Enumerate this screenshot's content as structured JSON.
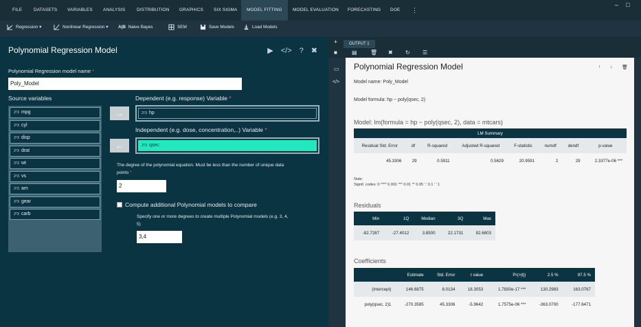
{
  "menubar": {
    "items": [
      "FILE",
      "DATASETS",
      "VARIABLES",
      "ANALYSIS",
      "DISTRIBUTION",
      "GRAPHICS",
      "SIX SIGMA",
      "MODEL FITTING",
      "MODEL EVALUATION",
      "FORECASTING",
      "DOE"
    ],
    "more_icon": "⋮",
    "minimize_icon": "–",
    "maximize_icon": "□",
    "active": "MODEL FITTING"
  },
  "toolbar": {
    "regression": "Regression",
    "nonlinear": "Nonlinear Regression",
    "naive_bayes": "Naive Bayes",
    "naive_prefix": "A|B",
    "sem": "SEM",
    "save_models": "Save Models",
    "load_models": "Load Models"
  },
  "dialog": {
    "title": "Polynomial Regression Model",
    "model_name_label": "Polynomial Regression model name",
    "model_name_value": "Poly_Model",
    "source_label": "Source variables",
    "source_vars": [
      "mpg",
      "cyl",
      "disp",
      "drat",
      "wt",
      "vs",
      "am",
      "gear",
      "carb"
    ],
    "var_icon": "2²3",
    "dependent_label": "Dependent (e.g. response) Variable",
    "dependent_value": "hp",
    "independent_label": "Independent (e.g. dose, concentration,..) Variable",
    "independent_value": "qsec",
    "degree_label_1": "The degree of the polynomial equation. Must be less than the number of unique data",
    "degree_label_2": "points",
    "degree_value": "2",
    "compare_label": "Compute additional Polynomial models to compare",
    "specify_label_1": "Specify one or more degrees to create multiple Polynomial models (e.g. 3, 4,",
    "specify_label_2": "5)",
    "specify_value": "3,4",
    "required_mark": "*",
    "arrow_right": "→",
    "arrow_left": "←",
    "action_run": "▶",
    "action_code": "</>",
    "action_help": "?",
    "action_close": "✖"
  },
  "output": {
    "tab": "OUTPUT 1",
    "plus": "+",
    "title": "Polynomial Regression Model",
    "model_name": "Model name: Poly_Model",
    "model_formula": "Model formula: hp ~ poly(qsec, 2)",
    "lm_heading": "Model: lm(formula = hp ~ poly(qsec, 2), data = mtcars)",
    "lm_caption": "LM Summary",
    "lm_headers": [
      "Residual Std. Error",
      "df",
      "R-squared",
      "Adjusted R-squared",
      "F-statistic",
      "numdf",
      "dendf",
      "p-value"
    ],
    "lm_row": [
      "45.3306",
      "29",
      "0.5911",
      "0.5629",
      "20.9591",
      "2",
      "29",
      "2.3377e-06 ***"
    ],
    "note": "Note:",
    "signif": "Signif. codes: 0 '***' 0.001 '**' 0.01 '*' 0.05 '.' 0.1 ' ' 1",
    "residuals_heading": "Residuals",
    "resid_headers": [
      "Min",
      "1Q",
      "Median",
      "3Q",
      "Max"
    ],
    "resid_row": [
      "-82.7287",
      "-27.4012",
      "3.8500",
      "22.1731",
      "82.6803"
    ],
    "coef_heading": "Coefficients",
    "coef_headers": [
      "",
      "Estimate",
      "Std. Error",
      "t value",
      "Pr(>|t|)",
      "2.5 %",
      "97.5 %"
    ],
    "coef_rows": [
      [
        "(Intercept)",
        "146.6875",
        "8.0134",
        "18.3053",
        "1.7830e-17 ***",
        "130.2983",
        "163.0767"
      ],
      [
        "poly(qsec, 2)1",
        "-270.3585",
        "45.3306",
        "-5.9642",
        "1.7575e-06 ***",
        "-363.0700",
        "-177.6471"
      ]
    ],
    "arrow_up": "↑",
    "arrow_down": "↓"
  }
}
